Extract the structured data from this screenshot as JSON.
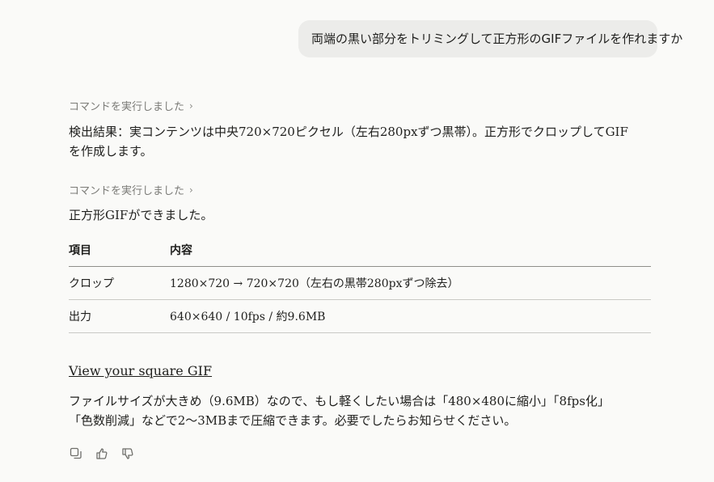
{
  "user_message": "両端の黒い部分をトリミングして正方形のGIFファイルを作れますか",
  "command_label_1": "コマンドを実行しました",
  "detection_text": "検出結果：実コンテンツは中央720×720ピクセル（左右280pxずつ黒帯）。正方形でクロップしてGIFを作成します。",
  "command_label_2": "コマンドを実行しました",
  "done_text": "正方形GIFができました。",
  "table": {
    "headers": [
      "項目",
      "内容"
    ],
    "rows": [
      [
        "クロップ",
        "1280×720 → 720×720（左右の黒帯280pxずつ除去）"
      ],
      [
        "出力",
        "640×640 / 10fps / 約9.6MB"
      ]
    ]
  },
  "link_text": "View your square GIF",
  "closing_text_line1": "ファイルサイズが大きめ（9.6MB）なので、もし軽くしたい場合は「480×480に縮小」「8fps化」",
  "closing_text_line2": "「色数削減」などで2〜3MBまで圧縮できます。必要でしたらお知らせください。",
  "icons": [
    "copy-icon",
    "thumbs-up-icon",
    "thumbs-down-icon"
  ]
}
